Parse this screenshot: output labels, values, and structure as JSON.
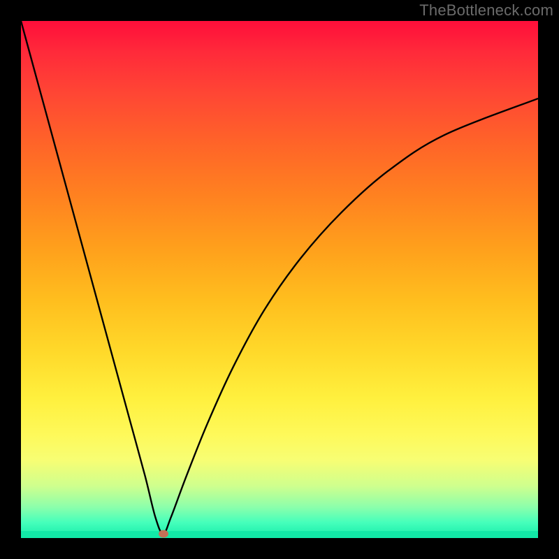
{
  "watermark": "TheBottleneck.com",
  "colors": {
    "frame": "#000000",
    "curve": "#000000",
    "marker": "#c57057",
    "gradient_top": "#ff0e3a",
    "gradient_bottom": "#14ecaa"
  },
  "chart_data": {
    "type": "line",
    "title": "",
    "xlabel": "",
    "ylabel": "",
    "xlim": [
      0,
      100
    ],
    "ylim": [
      0,
      100
    ],
    "marker_position": {
      "x": 27.5,
      "y": 0.8
    },
    "series": [
      {
        "name": "bottleneck-curve",
        "x": [
          0,
          3,
          6,
          9,
          12,
          15,
          18,
          21,
          24,
          26,
          27.5,
          29,
          32,
          36,
          41,
          47,
          54,
          62,
          71,
          82,
          100
        ],
        "y": [
          100,
          89,
          78,
          67,
          56,
          45,
          34,
          23,
          12,
          4,
          0.8,
          4,
          12,
          22,
          33,
          44,
          54,
          63,
          71,
          78,
          85
        ]
      }
    ],
    "annotations": []
  }
}
